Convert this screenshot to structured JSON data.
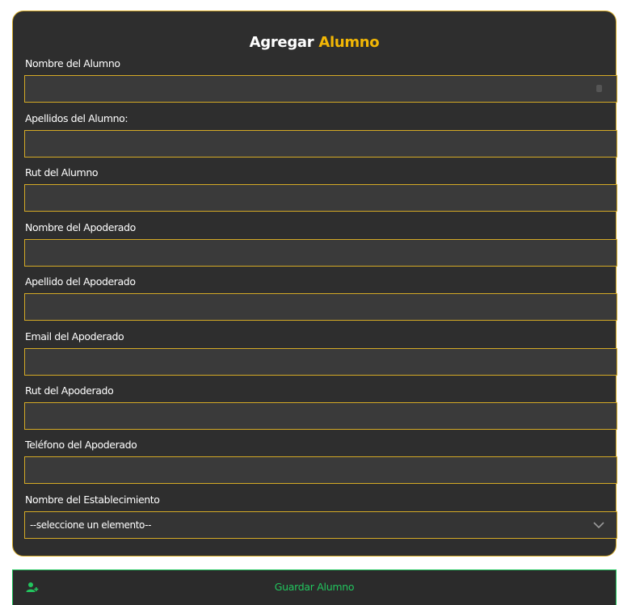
{
  "form": {
    "title_part1": "Agregar",
    "title_part2": "Alumno",
    "fields": [
      {
        "label": "Nombre del Alumno",
        "value": ""
      },
      {
        "label": "Apellidos del Alumno:",
        "value": ""
      },
      {
        "label": "Rut del Alumno",
        "value": ""
      },
      {
        "label": "Nombre del Apoderado",
        "value": ""
      },
      {
        "label": "Apellido del Apoderado",
        "value": ""
      },
      {
        "label": "Email del Apoderado",
        "value": ""
      },
      {
        "label": "Rut del Apoderado",
        "value": ""
      },
      {
        "label": "Teléfono del Apoderado",
        "value": ""
      }
    ],
    "select": {
      "label": "Nombre del Establecimiento",
      "selected": "--seleccione un elemento--"
    },
    "save_label": "Guardar Alumno"
  },
  "colors": {
    "card_bg": "#2e2e2e",
    "accent_yellow": "#f2b705",
    "border_gold": "#d4aa26",
    "save_green": "#22c55e"
  },
  "icons": {
    "select_chevron": "chevron-down-icon",
    "save": "user-add-icon"
  }
}
